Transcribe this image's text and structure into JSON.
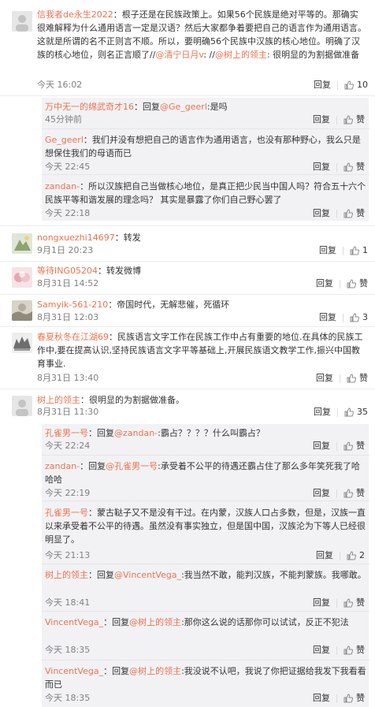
{
  "labels": {
    "reply": "回复",
    "like": "赞"
  },
  "colors": {
    "username": "#eb7350",
    "time": "#808080",
    "reply_bg": "#f2f2f5"
  },
  "comments": [
    {
      "user": "信我者de永生2022",
      "pre": "：根子还是在民族政策上。如果56个民族是绝对平等的。那确实很难解释为什么通用语言一定是汉语？然后大家都争着要把自己的语言作为通用语言。这就是所谓的名不正则言不顺。所以，要明确56个民族中汉族的核心地位。明确了汉族的核心地位，则名正言顺了//",
      "m1": "@清宁日月v",
      "mid": ": //",
      "m2": "@树上的领主",
      "post": ": 很明显的为割据做准备",
      "time": "今天 16:02",
      "likes": "10",
      "replies": [
        {
          "user": "万中无一的绵武奇才16",
          "pre": "：回复",
          "m1": "@Ge_geerl",
          "post": ":是吗",
          "time": "45分钟前",
          "likes": "赞"
        },
        {
          "user": "Ge_geerl",
          "pre": "：我们并没有想把自己的语言作为通用语言，也没有那种野心，我么只是想保住我们的母语而已",
          "time": "今天 22:45",
          "likes": "赞"
        },
        {
          "user": "zandan-",
          "pre": "：所以汉族把自己当做核心地位，是真正把少民当中国人吗？符合五十六个民族平等和谐发展的理念吗？ 其实是暴露了你们自己野心罢了",
          "time": "今天 22:18",
          "likes": "赞"
        }
      ]
    },
    {
      "user": "nongxuezhi14697",
      "pre": "：转发",
      "time": "9月1日 20:23",
      "likes": "1"
    },
    {
      "user": "等待ING05204",
      "pre": "：转发微博",
      "time": "8月31日 14:52",
      "likes": "赞"
    },
    {
      "user": "Samyik-561-210",
      "pre": "：帝国时代，无解悲催，死循环",
      "time": "8月31日 12:03",
      "likes": "3"
    },
    {
      "user": "春夏秋冬在江湖69",
      "pre": "：民族语言文字工作在民族工作中占有重要的地位.在具体的民族工作中,要在提高认识,坚持民族语言文字平等基础上,开展民族语文教学工作,振兴中国教育事业.",
      "time": "8月31日 13:40",
      "likes": "赞"
    },
    {
      "user": "树上的领主",
      "pre": "：很明显的为割据做准备。",
      "time": "8月31日 11:30",
      "likes": "35",
      "replies": [
        {
          "user": "孔雀男一号",
          "pre": "：回复",
          "m1": "@zandan-",
          "post": ":霸占？？？？什么叫霸占？",
          "time": "今天 22:24",
          "likes": "赞"
        },
        {
          "user": "zandan-",
          "pre": "：回复",
          "m1": "@孔雀男一号",
          "post": ":承受着不公平的待遇还霸占住了那么多年笑死我了哈哈哈",
          "time": "今天 22:19",
          "likes": "赞"
        },
        {
          "user": "孔雀男一号",
          "pre": "：蒙古鞑子又不是没有干过。在内蒙，汉族人口占多数，但是，汉族一直以来承受着不公平的待遇。虽然没有事实独立，但是国中国，汉族沦为下等人已经很明显了。",
          "time": "今天 21:13",
          "likes": "2"
        },
        {
          "user": "树上的领主",
          "pre": "：回复",
          "m1": "@VincentVega_",
          "post": ":我当然不敢，能判汉族，不能判蒙族。我哪敢。",
          "time": "今天 18:41",
          "likes": "赞"
        },
        {
          "user": "VincentVega_",
          "pre": "：回复",
          "m1": "@树上的领主",
          "post": ":那你这么说的话那你可以试试，反正不犯法",
          "time": "今天 18:35",
          "likes": "赞"
        },
        {
          "user": "VincentVega_",
          "pre": "：回复",
          "m1": "@树上的领主",
          "post": ":我没说不认吧，我说了你把证据给我发下我看看而已",
          "time": "今天 18:35",
          "likes": "赞"
        }
      ]
    }
  ]
}
